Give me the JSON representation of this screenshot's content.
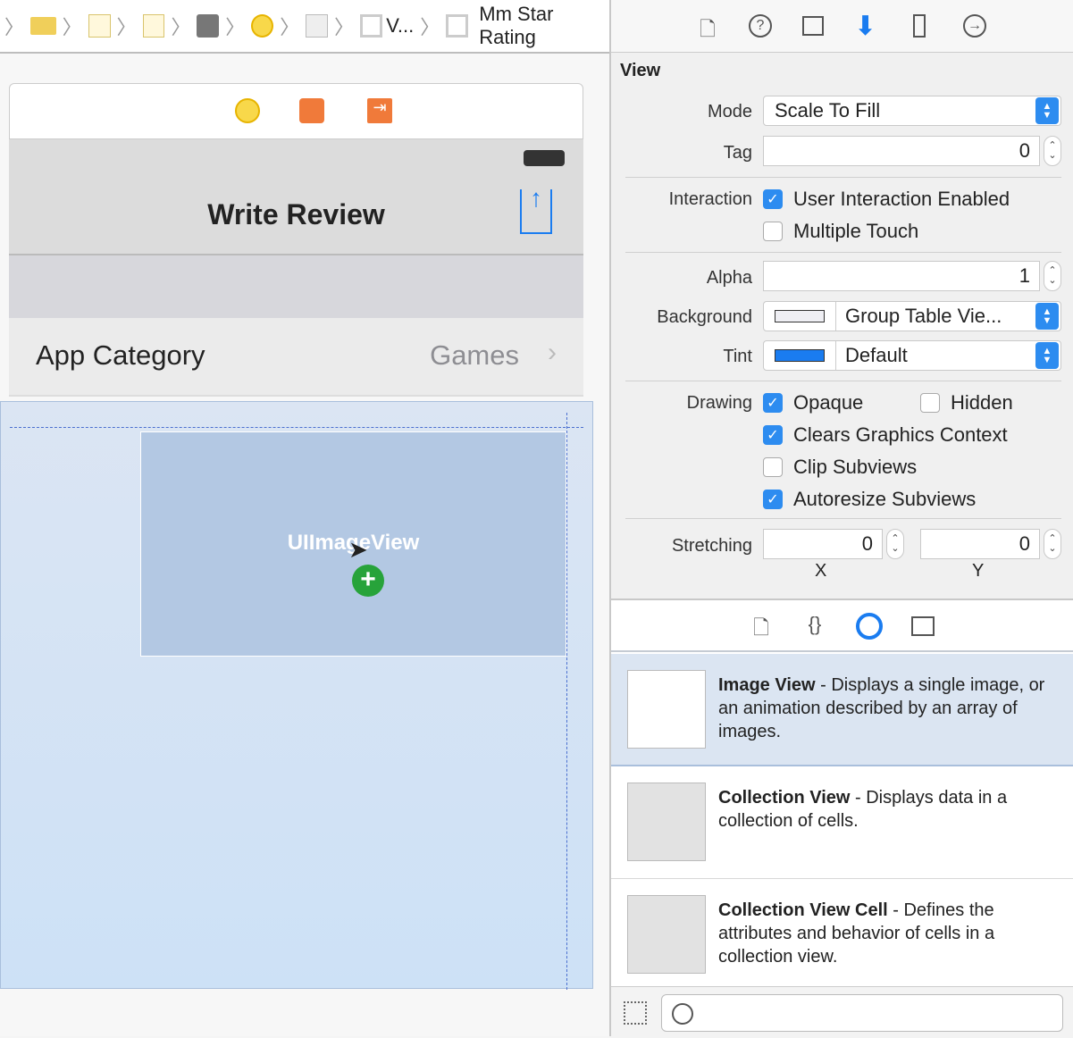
{
  "breadcrumb": {
    "items": [
      "folder-icon",
      "file-icon",
      "file-icon",
      "scene-icon",
      "controller-icon",
      "view-icon",
      "V...",
      "Mm Star Rating"
    ]
  },
  "scene": {
    "dock_icons": [
      "view-controller-icon",
      "first-responder-icon",
      "exit-icon"
    ],
    "nav_title": "Write Review",
    "row_label": "App Category",
    "row_value": "Games",
    "image_view_label": "UIImageView"
  },
  "inspector": {
    "tabs": [
      "file-icon",
      "help-icon",
      "identity-icon",
      "attributes-icon",
      "size-icon",
      "connections-icon"
    ],
    "section": "View",
    "mode_label": "Mode",
    "mode_value": "Scale To Fill",
    "tag_label": "Tag",
    "tag_value": "0",
    "interaction_label": "Interaction",
    "user_interaction": {
      "label": "User Interaction Enabled",
      "checked": true
    },
    "multiple_touch": {
      "label": "Multiple Touch",
      "checked": false
    },
    "alpha_label": "Alpha",
    "alpha_value": "1",
    "background_label": "Background",
    "background_value": "Group Table Vie...",
    "tint_label": "Tint",
    "tint_value": "Default",
    "tint_color": "#1a7cf0",
    "drawing_label": "Drawing",
    "opaque": {
      "label": "Opaque",
      "checked": true
    },
    "hidden": {
      "label": "Hidden",
      "checked": false
    },
    "clears": {
      "label": "Clears Graphics Context",
      "checked": true
    },
    "clip": {
      "label": "Clip Subviews",
      "checked": false
    },
    "autoresize": {
      "label": "Autoresize Subviews",
      "checked": true
    },
    "stretching_label": "Stretching",
    "stretch_x": "0",
    "stretch_y": "0",
    "x_label": "X",
    "y_label": "Y"
  },
  "library": {
    "tabs": [
      "file-template-icon",
      "code-snippet-icon",
      "object-icon",
      "media-icon"
    ],
    "items": [
      {
        "title": "Image View",
        "desc": " - Displays a single image, or an animation described by an array of images.",
        "selected": true
      },
      {
        "title": "Collection View",
        "desc": " - Displays data in a collection of cells."
      },
      {
        "title": "Collection View Cell",
        "desc": " - Defines the attributes and behavior of cells in a collection view."
      }
    ],
    "filter_placeholder": ""
  }
}
